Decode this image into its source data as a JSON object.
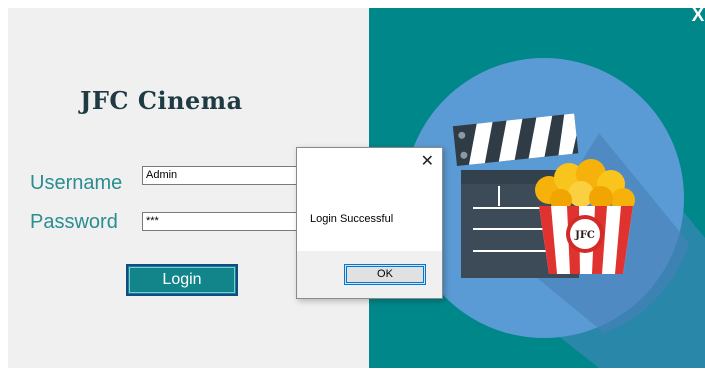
{
  "window": {
    "close_glyph": "X"
  },
  "login": {
    "app_title": "JFC Cinema",
    "username_label": "Username",
    "username_value": "Admin",
    "password_label": "Password",
    "password_value": "***",
    "login_button": "Login"
  },
  "dialog": {
    "close_glyph": "✕",
    "message": "Login Successful",
    "ok_button": "OK"
  },
  "illustration": {
    "logo_text": "JFC"
  },
  "colors": {
    "panel_bg": "#f0f0f0",
    "teal": "#00878a",
    "circle": "#5b9bd5",
    "accent_text": "#2a8d90"
  }
}
